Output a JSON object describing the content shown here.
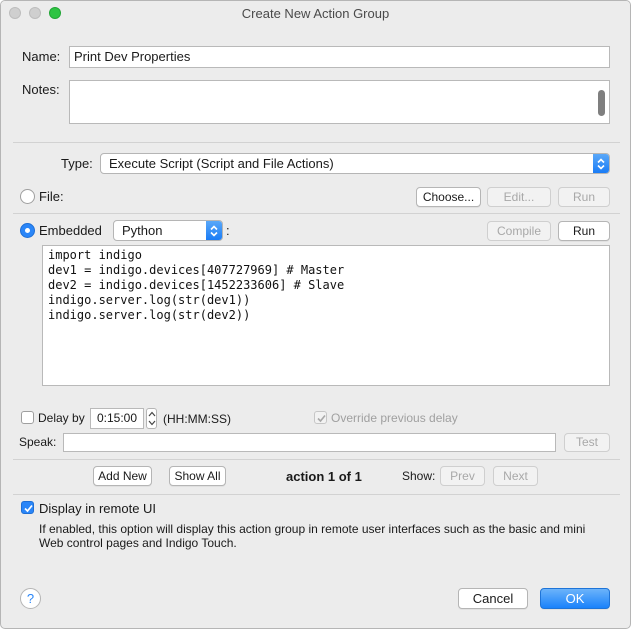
{
  "window": {
    "title": "Create New Action Group"
  },
  "name": {
    "label": "Name:",
    "value": "Print Dev Properties"
  },
  "notes": {
    "label": "Notes:",
    "value": ""
  },
  "type": {
    "label": "Type:",
    "value": "Execute Script (Script and File Actions)"
  },
  "file": {
    "label": "File:",
    "choose": "Choose...",
    "edit": "Edit...",
    "run": "Run"
  },
  "embedded": {
    "label": "Embedded",
    "language": "Python",
    "colon": ":",
    "compile": "Compile",
    "run": "Run"
  },
  "script_lines": [
    "import indigo",
    "dev1 = indigo.devices[407727969] # Master",
    "dev2 = indigo.devices[1452233606] # Slave",
    "indigo.server.log(str(dev1))",
    "indigo.server.log(str(dev2))"
  ],
  "delay": {
    "label": "Delay by",
    "value": "0:15:00",
    "format": "(HH:MM:SS)",
    "override_label": "Override previous delay"
  },
  "speak": {
    "label": "Speak:",
    "value": "",
    "test": "Test"
  },
  "actions": {
    "add_new": "Add New",
    "show_all": "Show All",
    "counter": "action 1 of 1",
    "show_label": "Show:",
    "prev": "Prev",
    "next": "Next"
  },
  "remote": {
    "label": "Display in remote UI",
    "checked": true,
    "help_text": "If enabled, this option will display this action group in remote user interfaces such as the basic and mini Web control pages and Indigo Touch."
  },
  "footer": {
    "help": "?",
    "cancel": "Cancel",
    "ok": "OK"
  },
  "colors": {
    "accent": "#2a86f8",
    "zoom": "#2ec443"
  }
}
